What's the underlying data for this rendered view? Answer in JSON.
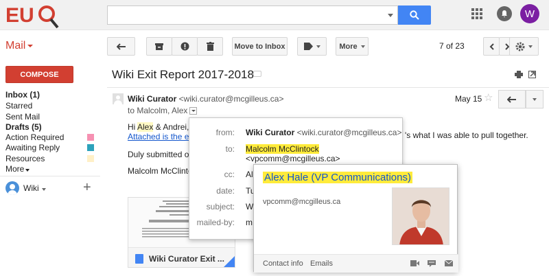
{
  "brand": {
    "logo_text": "EUS",
    "accent": "#d23f31",
    "search_blue": "#4285f4"
  },
  "header": {
    "search_placeholder": "",
    "avatar_initial": "W"
  },
  "toolbar": {
    "mail_label": "Mail",
    "move_to_inbox": "Move to Inbox",
    "more": "More",
    "pager": "7 of 23"
  },
  "sidebar": {
    "compose": "COMPOSE",
    "items": [
      {
        "label": "Inbox (1)",
        "bold": true
      },
      {
        "label": "Starred",
        "bold": false
      },
      {
        "label": "Sent Mail",
        "bold": false
      },
      {
        "label": "Drafts (5)",
        "bold": true
      },
      {
        "label": "Action Required",
        "color": "#f691b2"
      },
      {
        "label": "Awaiting Reply",
        "color": "#2da2bb"
      },
      {
        "label": "Resources",
        "color": "#fff0c7"
      },
      {
        "label": "More"
      }
    ],
    "hangout_name": "Wiki"
  },
  "message": {
    "subject": "Wiki Exit Report 2017-2018",
    "sender_name": "Wiki Curator",
    "sender_email": "<wiki.curator@mcgilleus.ca>",
    "to_line": "to Malcolm, Alex",
    "date": "May 15",
    "greeting_pre": "Hi ",
    "greeting_name": "Alex",
    "greeting_post": " & Andrei,",
    "link_text": "Attached is the ex",
    "body_right": "'s what I was able to pull together.",
    "line2": "Duly submitted or",
    "signature": "Malcolm McClinto",
    "attachment_name": "Wiki Curator Exit ..."
  },
  "details": {
    "from_label": "from:",
    "from_name": "Wiki Curator",
    "from_email": "<wiki.curator@mcgilleus.ca>",
    "to_label": "to:",
    "to_name": "Malcolm McClintock",
    "to_email": "<vpcomm@mcgilleus.ca>",
    "cc_label": "cc:",
    "cc_value": "Al",
    "date_label": "date:",
    "date_value": "Tu",
    "subject_label": "subject:",
    "subject_value": "W",
    "mailedby_label": "mailed-by:",
    "mailedby_value": "m"
  },
  "hovercard": {
    "name": "Alex Hale (VP Communications)",
    "email": "vpcomm@mcgilleus.ca",
    "contact_info": "Contact info",
    "emails": "Emails"
  }
}
